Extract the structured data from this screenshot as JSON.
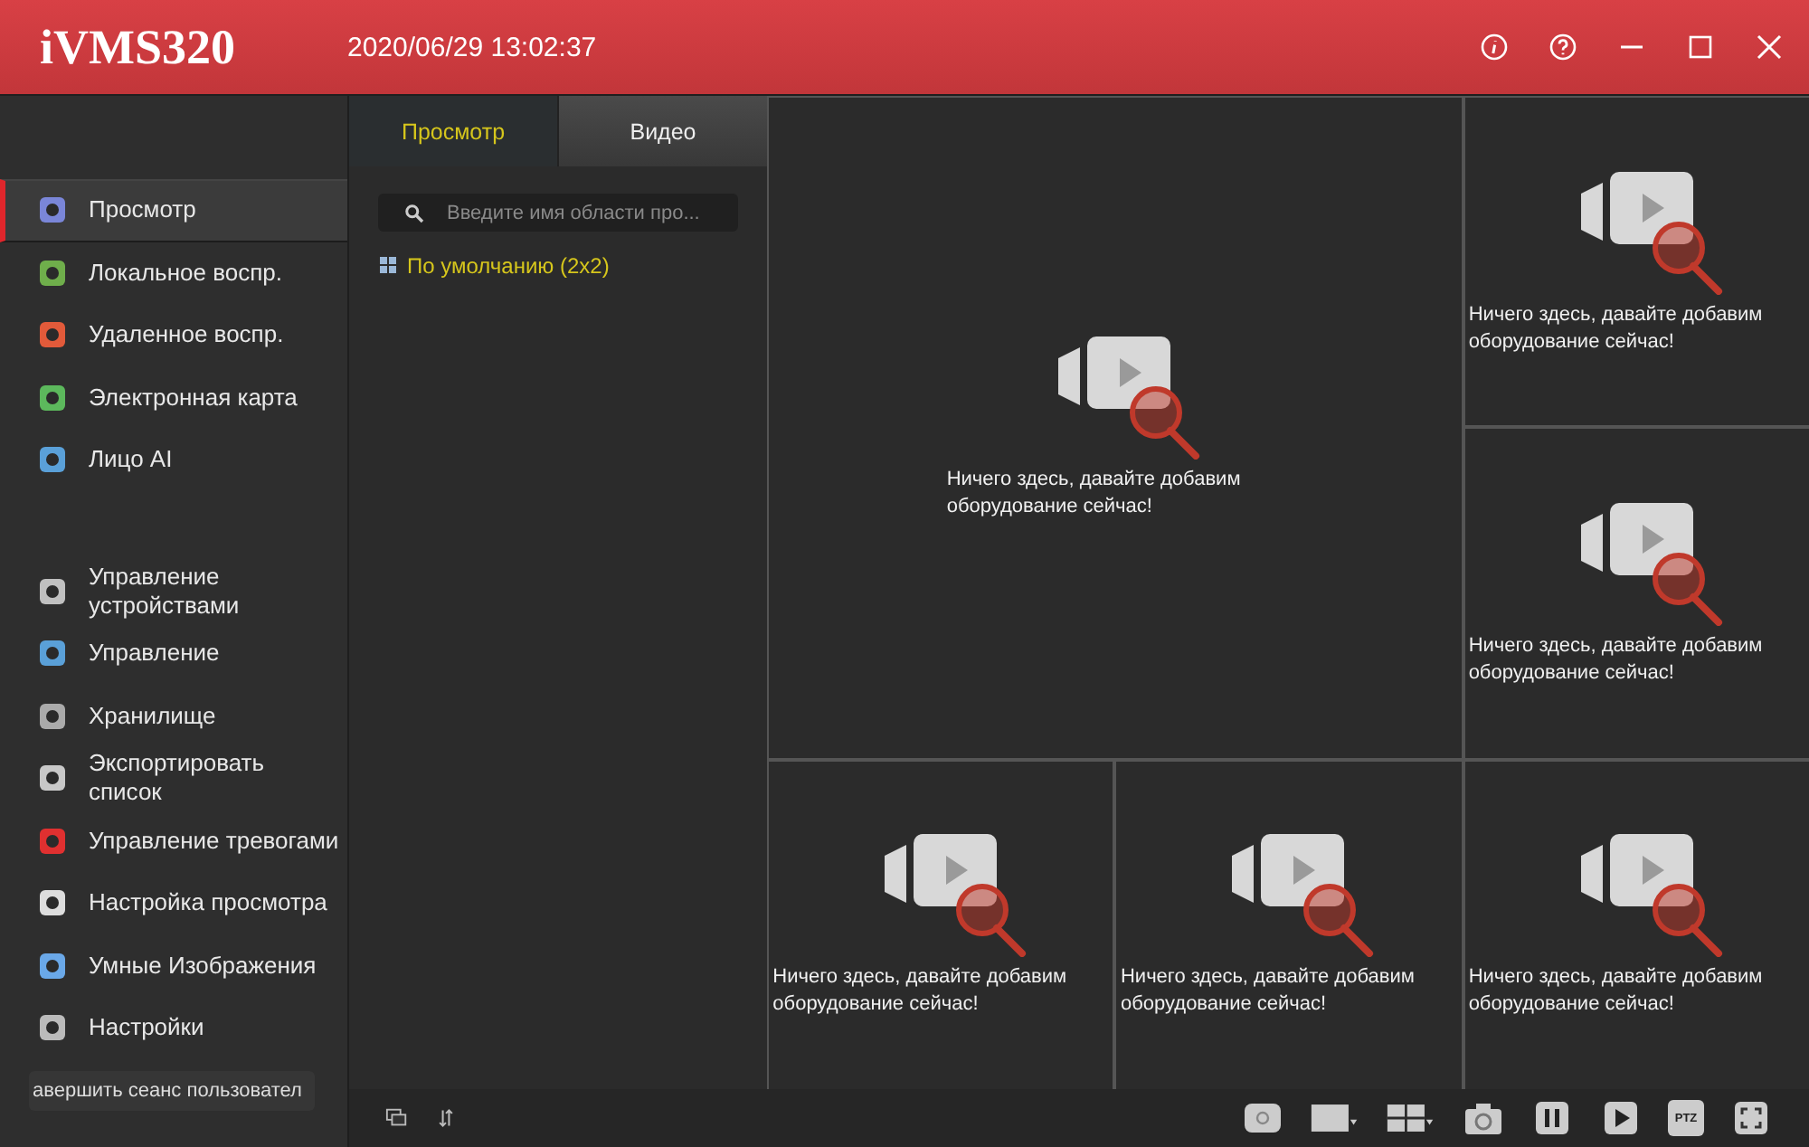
{
  "header": {
    "logo": "iVMS320",
    "datetime": "2020/06/29 13:02:37"
  },
  "sidebar": {
    "groups": [
      [
        {
          "label": "Просмотр",
          "selected": true
        },
        {
          "label": "Локальное воспр.",
          "selected": false
        },
        {
          "label": "Удаленное воспр.",
          "selected": false
        },
        {
          "label": "Электронная карта",
          "selected": false
        },
        {
          "label": "Лицо AI",
          "selected": false
        }
      ],
      [
        {
          "label": "Управление устройствами",
          "selected": false
        },
        {
          "label": "Управление",
          "selected": false
        },
        {
          "label": "Хранилище",
          "selected": false
        },
        {
          "label": "Экспортировать список",
          "selected": false
        },
        {
          "label": "Управление тревогами",
          "selected": false
        },
        {
          "label": "Настройка просмотра",
          "selected": false
        },
        {
          "label": "Умные Изображения",
          "selected": false
        },
        {
          "label": "Настройки",
          "selected": false
        }
      ]
    ],
    "logout": "авершить сеанс пользовател"
  },
  "panel": {
    "tabs": [
      {
        "label": "Просмотр",
        "selected": true
      },
      {
        "label": "Видео",
        "selected": false
      }
    ],
    "search": {
      "placeholder": "Введите имя области про..."
    },
    "tree": [
      {
        "label": "По умолчанию (2x2)"
      }
    ]
  },
  "video_grid": {
    "cells": [
      {
        "message": "Ничего здесь, давайте добавим оборудование сейчас!"
      },
      {
        "message": "Ничего здесь, давайте добавим оборудование сейчас!"
      },
      {
        "message": "Ничего здесь, давайте добавим оборудование сейчас!"
      },
      {
        "message": "Ничего здесь, давайте добавим оборудование сейчас!"
      },
      {
        "message": "Ничего здесь, давайте добавим оборудование сейчас!"
      },
      {
        "message": "Ничего здесь, давайте добавим оборудование сейчас!"
      }
    ]
  },
  "toolbar": [
    {
      "kind": "record"
    },
    {
      "kind": "single"
    },
    {
      "kind": "layout"
    },
    {
      "kind": "snapshot"
    },
    {
      "kind": "pause"
    },
    {
      "kind": "play"
    },
    {
      "kind": "ptz",
      "label": "PTZ"
    },
    {
      "kind": "fullscreen"
    }
  ]
}
